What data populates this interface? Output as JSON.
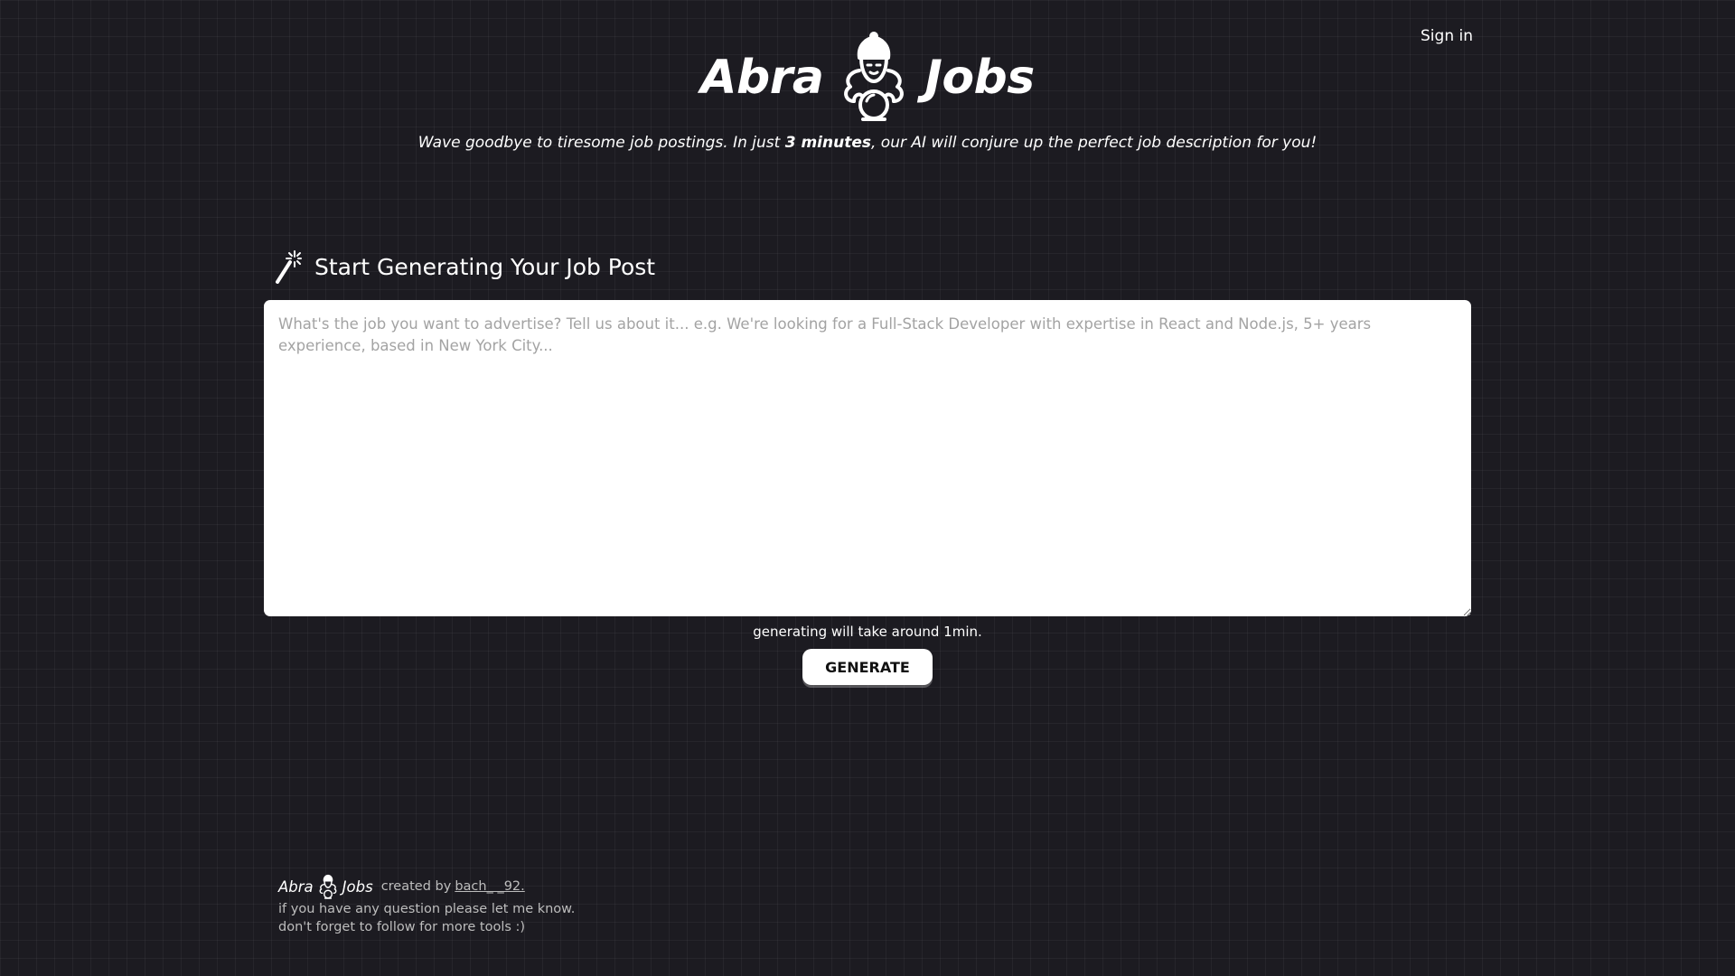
{
  "header": {
    "sign_in": "Sign in",
    "logo_left": "Abra",
    "logo_right": "Jobs",
    "tagline_before": "Wave goodbye to tiresome job postings. In just ",
    "tagline_bold": "3 minutes",
    "tagline_after": ", our AI will conjure up the perfect job description for you!"
  },
  "main": {
    "section_title": "Start Generating Your Job Post",
    "prompt_placeholder": "What's the job you want to advertise? Tell us about it... e.g. We're looking for a Full-Stack Developer with expertise in React and Node.js, 5+ years experience, based in New York City...",
    "prompt_value": "",
    "hint": "generating will take around 1min.",
    "generate_label": "GENERATE"
  },
  "footer": {
    "logo_left": "Abra",
    "logo_right": "Jobs",
    "created_by": "created by",
    "author": "bach_ _92.",
    "line1": "if you have any question please let me know.",
    "line2": "don't forget to follow for more tools :)"
  },
  "colors": {
    "background": "#1c1b21",
    "accent": "#ffffff"
  },
  "icons": {
    "logo": "genie-crystal-ball-icon",
    "section": "magic-wand-icon"
  }
}
